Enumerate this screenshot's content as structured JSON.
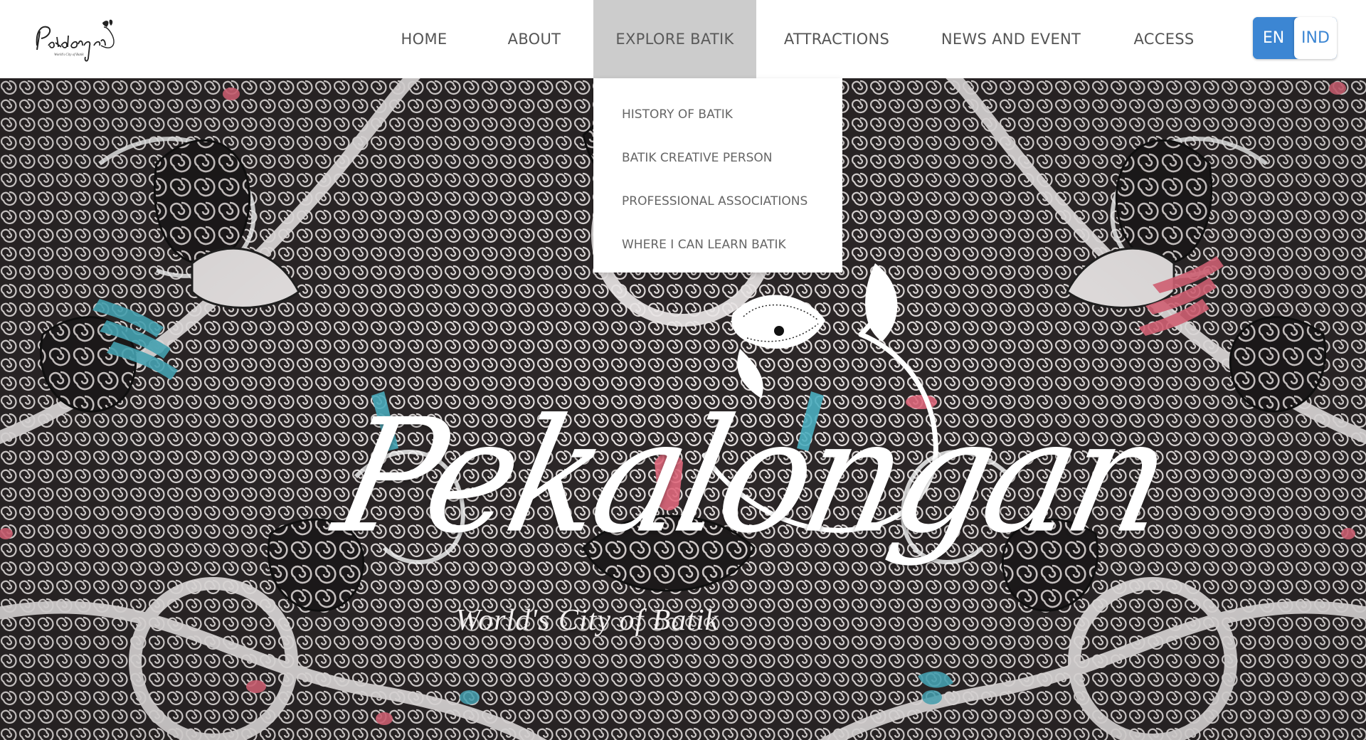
{
  "site": {
    "logo_text": "Pekalongan",
    "logo_subtext": "World's City of Batik"
  },
  "nav": {
    "items": [
      {
        "label": "HOME"
      },
      {
        "label": "ABOUT"
      },
      {
        "label": "EXPLORE BATIK",
        "active": true
      },
      {
        "label": "ATTRACTIONS"
      },
      {
        "label": "NEWS AND EVENT"
      },
      {
        "label": "ACCESS"
      }
    ]
  },
  "language": {
    "options": [
      "EN",
      "IND"
    ],
    "selected": "EN"
  },
  "dropdown": {
    "parent": "EXPLORE BATIK",
    "items": [
      {
        "label": "HISTORY OF BATIK"
      },
      {
        "label": "BATIK CREATIVE PERSON"
      },
      {
        "label": "PROFESSIONAL ASSOCIATIONS"
      },
      {
        "label": "WHERE I CAN LEARN BATIK"
      }
    ]
  },
  "hero": {
    "title": "Pekalongan",
    "tagline": "World's City of Batik"
  },
  "colors": {
    "accent": "#3c86d3",
    "active_nav_bg": "#cccccc",
    "nav_text": "#555555"
  },
  "icons": [
    "logo-flower-icon",
    "hero-flower-icon"
  ]
}
